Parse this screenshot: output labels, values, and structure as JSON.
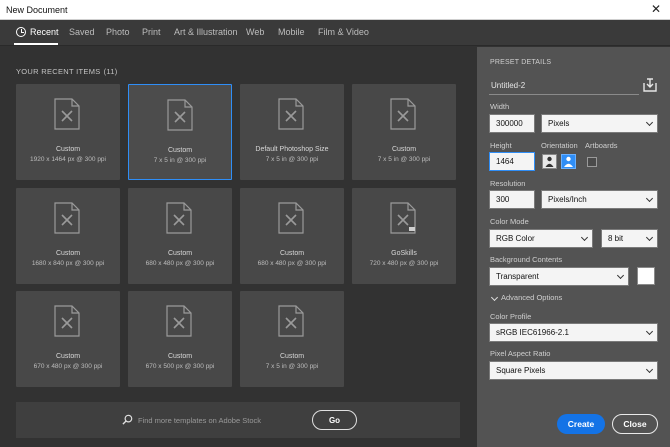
{
  "window": {
    "title": "New Document"
  },
  "tabs": [
    {
      "label": "Recent",
      "active": true
    },
    {
      "label": "Saved"
    },
    {
      "label": "Photo"
    },
    {
      "label": "Print"
    },
    {
      "label": "Art & Illustration"
    },
    {
      "label": "Web"
    },
    {
      "label": "Mobile"
    },
    {
      "label": "Film & Video"
    }
  ],
  "recent": {
    "heading": "YOUR RECENT ITEMS",
    "count": "(11)",
    "items": [
      {
        "name": "Custom",
        "dims": "1920 x 1464 px @ 300 ppi",
        "icon": "document-icon"
      },
      {
        "name": "Custom",
        "dims": "7 x 5 in @ 300 ppi",
        "icon": "document-icon",
        "selected": true
      },
      {
        "name": "Default Photoshop Size",
        "dims": "7 x 5 in @ 300 ppi",
        "icon": "document-icon"
      },
      {
        "name": "Custom",
        "dims": "7 x 5 in @ 300 ppi",
        "icon": "document-icon"
      },
      {
        "name": "Custom",
        "dims": "1680 x 840 px @ 300 ppi",
        "icon": "document-icon"
      },
      {
        "name": "Custom",
        "dims": "680 x 480 px @ 300 ppi",
        "icon": "document-icon"
      },
      {
        "name": "Custom",
        "dims": "680 x 480 px @ 300 ppi",
        "icon": "document-icon"
      },
      {
        "name": "GoSkills",
        "dims": "720 x 480 px @ 300 ppi",
        "icon": "template-document-icon"
      },
      {
        "name": "Custom",
        "dims": "670 x 480 px @ 300 ppi",
        "icon": "document-icon"
      },
      {
        "name": "Custom",
        "dims": "670 x 500 px @ 300 ppi",
        "icon": "document-icon"
      },
      {
        "name": "Custom",
        "dims": "7 x 5 in @ 300 ppi",
        "icon": "document-icon"
      }
    ]
  },
  "search": {
    "placeholder": "Find more templates on Adobe Stock",
    "go_label": "Go"
  },
  "preset": {
    "heading": "PRESET DETAILS",
    "doc_name": "Untitled-2",
    "width_label": "Width",
    "width_value": "300000",
    "width_unit": "Pixels",
    "height_label": "Height",
    "height_value": "1464",
    "orientation_label": "Orientation",
    "artboards_label": "Artboards",
    "resolution_label": "Resolution",
    "resolution_value": "300",
    "resolution_unit": "Pixels/Inch",
    "color_mode_label": "Color Mode",
    "color_mode_value": "RGB Color",
    "bit_depth": "8 bit",
    "background_label": "Background Contents",
    "background_value": "Transparent",
    "advanced_label": "Advanced Options",
    "color_profile_label": "Color Profile",
    "color_profile_value": "sRGB IEC61966-2.1",
    "pixel_aspect_label": "Pixel Aspect Ratio",
    "pixel_aspect_value": "Square Pixels",
    "create_label": "Create",
    "close_label": "Close"
  },
  "colors": {
    "accent": "#1473e6",
    "selection": "#2f8ef7",
    "panel": "#535353",
    "card": "#484848"
  }
}
